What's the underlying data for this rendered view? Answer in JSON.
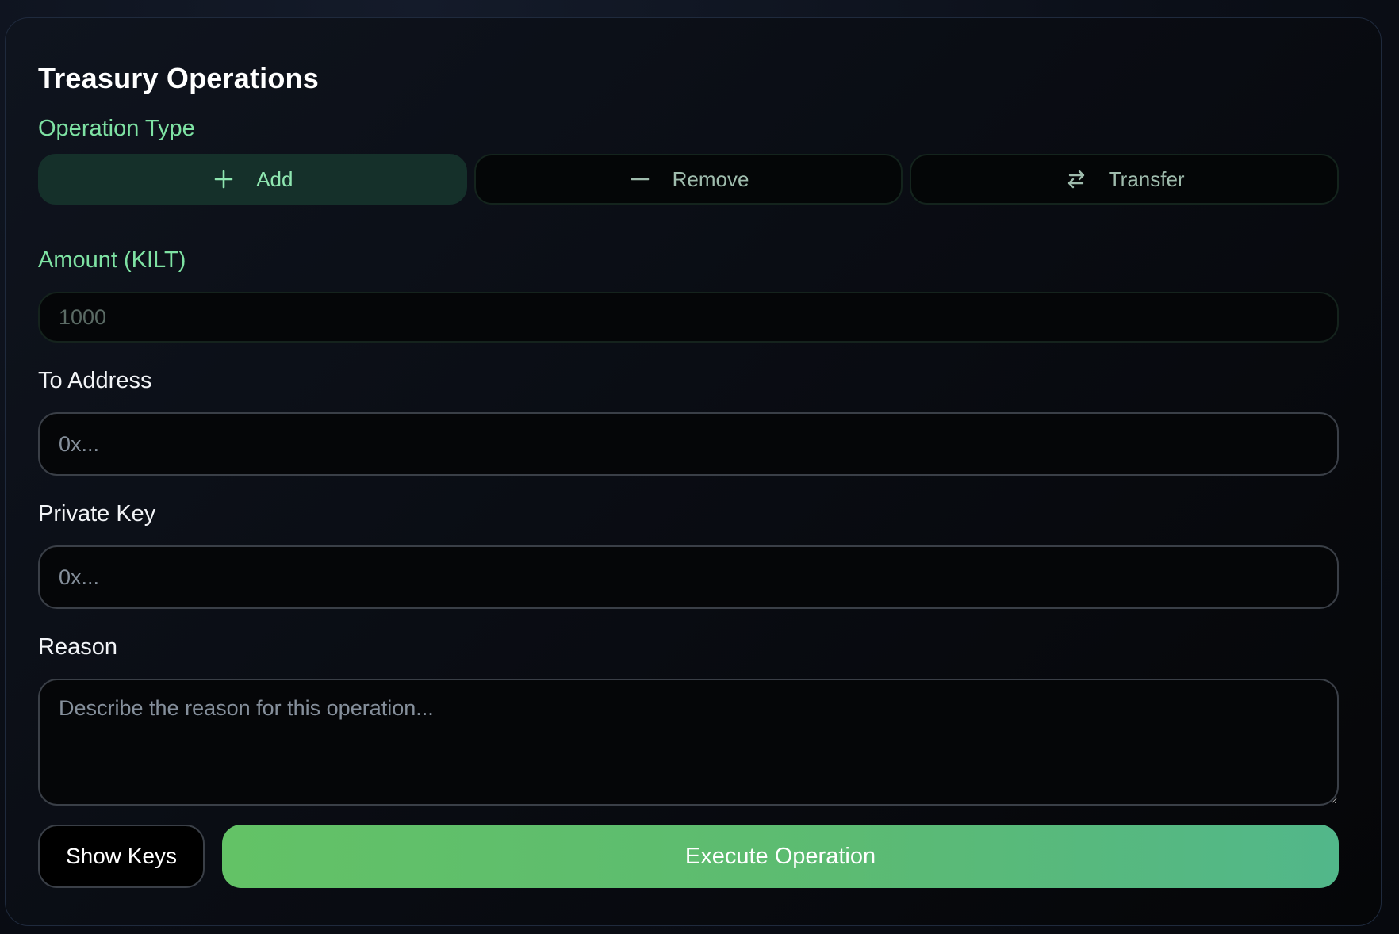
{
  "panel": {
    "title": "Treasury Operations"
  },
  "operation_type": {
    "label": "Operation Type",
    "options": [
      {
        "label": "Add",
        "icon": "plus-icon",
        "active": true
      },
      {
        "label": "Remove",
        "icon": "minus-icon",
        "active": false
      },
      {
        "label": "Transfer",
        "icon": "transfer-arrows-icon",
        "active": false
      }
    ]
  },
  "amount": {
    "label": "Amount (KILT)",
    "placeholder": "1000",
    "value": ""
  },
  "to_address": {
    "label": "To Address",
    "placeholder": "0x...",
    "value": ""
  },
  "private_key": {
    "label": "Private Key",
    "placeholder": "0x...",
    "value": ""
  },
  "reason": {
    "label": "Reason",
    "placeholder": "Describe the reason for this operation...",
    "value": ""
  },
  "actions": {
    "show_keys_label": "Show Keys",
    "execute_label": "Execute Operation"
  },
  "colors": {
    "accent_green": "#7ee2a3",
    "active_bg": "#15302a",
    "execute_start": "#63c266",
    "execute_end": "#52b78a"
  }
}
